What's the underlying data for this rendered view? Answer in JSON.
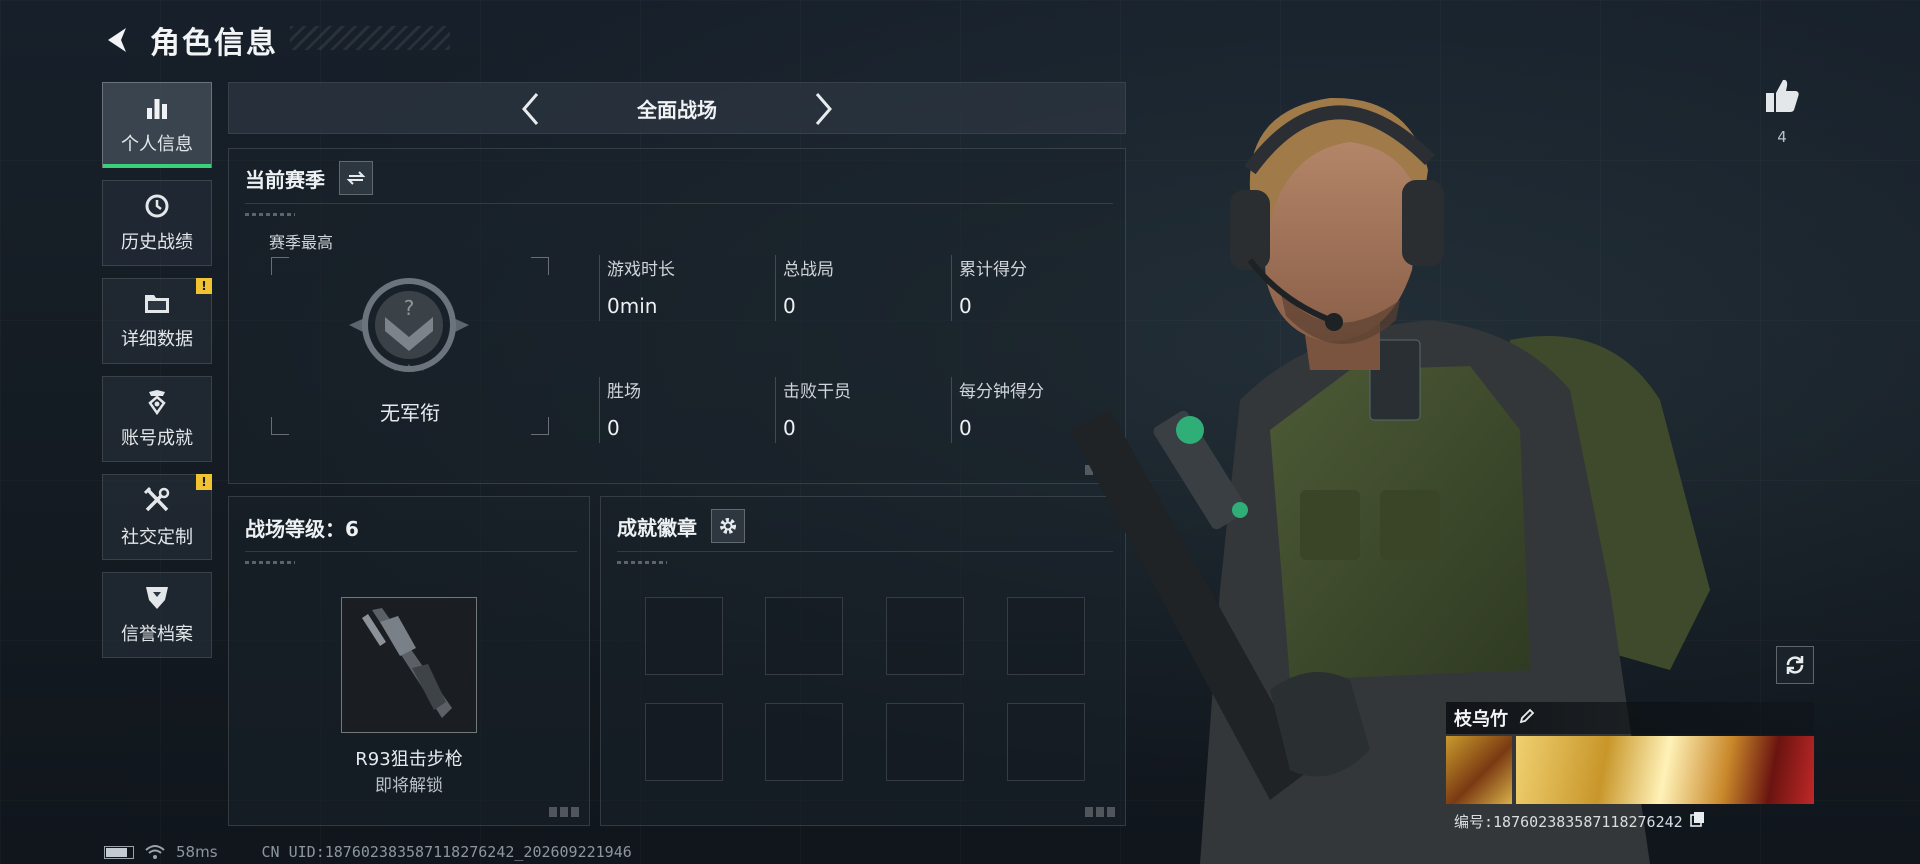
{
  "header": {
    "title": "角色信息"
  },
  "sidebar": {
    "items": [
      {
        "label": "个人信息",
        "icon": "bar-chart-icon",
        "active": true,
        "alert": false
      },
      {
        "label": "历史战绩",
        "icon": "clock-icon",
        "active": false,
        "alert": false
      },
      {
        "label": "详细数据",
        "icon": "folder-icon",
        "active": false,
        "alert": true
      },
      {
        "label": "账号成就",
        "icon": "achievement-icon",
        "active": false,
        "alert": false
      },
      {
        "label": "社交定制",
        "icon": "tools-icon",
        "active": false,
        "alert": true
      },
      {
        "label": "信誉档案",
        "icon": "shield-icon",
        "active": false,
        "alert": false
      }
    ],
    "alert_mark": "!"
  },
  "mode": {
    "label": "全面战场"
  },
  "season": {
    "title": "当前赛季",
    "rank_caption": "赛季最高",
    "rank_name": "无军衔",
    "stats": [
      {
        "label": "游戏时长",
        "value": "0min"
      },
      {
        "label": "总战局",
        "value": "0"
      },
      {
        "label": "累计得分",
        "value": "0"
      },
      {
        "label": "胜场",
        "value": "0"
      },
      {
        "label": "击败干员",
        "value": "0"
      },
      {
        "label": "每分钟得分",
        "value": "0"
      }
    ]
  },
  "level": {
    "title": "战场等级：6",
    "weapon_name": "R93狙击步枪",
    "weapon_status": "即将解锁"
  },
  "badges": {
    "title": "成就徽章",
    "slot_count": 8
  },
  "likes": {
    "count": "4"
  },
  "player": {
    "name": "枝乌竹",
    "id_text": "编号:187602383587118276242"
  },
  "status": {
    "ping": "58ms",
    "uid": "CN UID:187602383587118276242_202609221946"
  },
  "colors": {
    "accent": "#3ad17a",
    "alert": "#f1c232"
  }
}
